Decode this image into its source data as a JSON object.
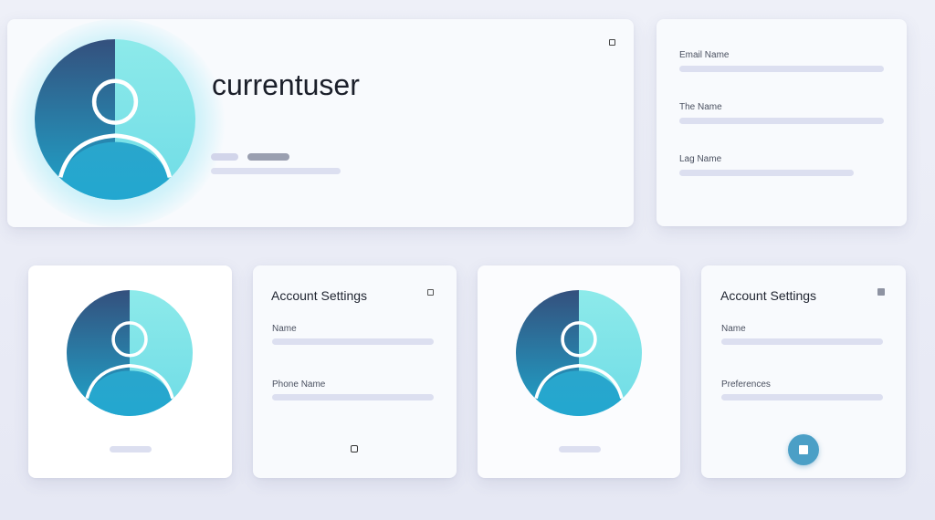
{
  "profile": {
    "username": "currentuser",
    "badge_icon": "grid-icon",
    "details": [
      {
        "label": "Email Name"
      },
      {
        "label": "The Name"
      },
      {
        "label": "Lag Name"
      }
    ]
  },
  "cards": [
    {
      "type": "avatar"
    },
    {
      "title": "Account Settings",
      "fields": [
        "Name",
        "Phone Name"
      ],
      "icon": "grid-icon",
      "footer_icon": "grid-icon"
    },
    {
      "type": "avatar"
    },
    {
      "title": "Account Settings",
      "fields": [
        "Name",
        "Preferences"
      ],
      "icon": "square-icon",
      "action_icon": "stop-icon"
    }
  ],
  "colors": {
    "avatar_dark": "#3a4f7a",
    "avatar_light": "#8ee8ec",
    "avatar_body": "#22aacb",
    "accent_button": "#4b9fc6"
  }
}
